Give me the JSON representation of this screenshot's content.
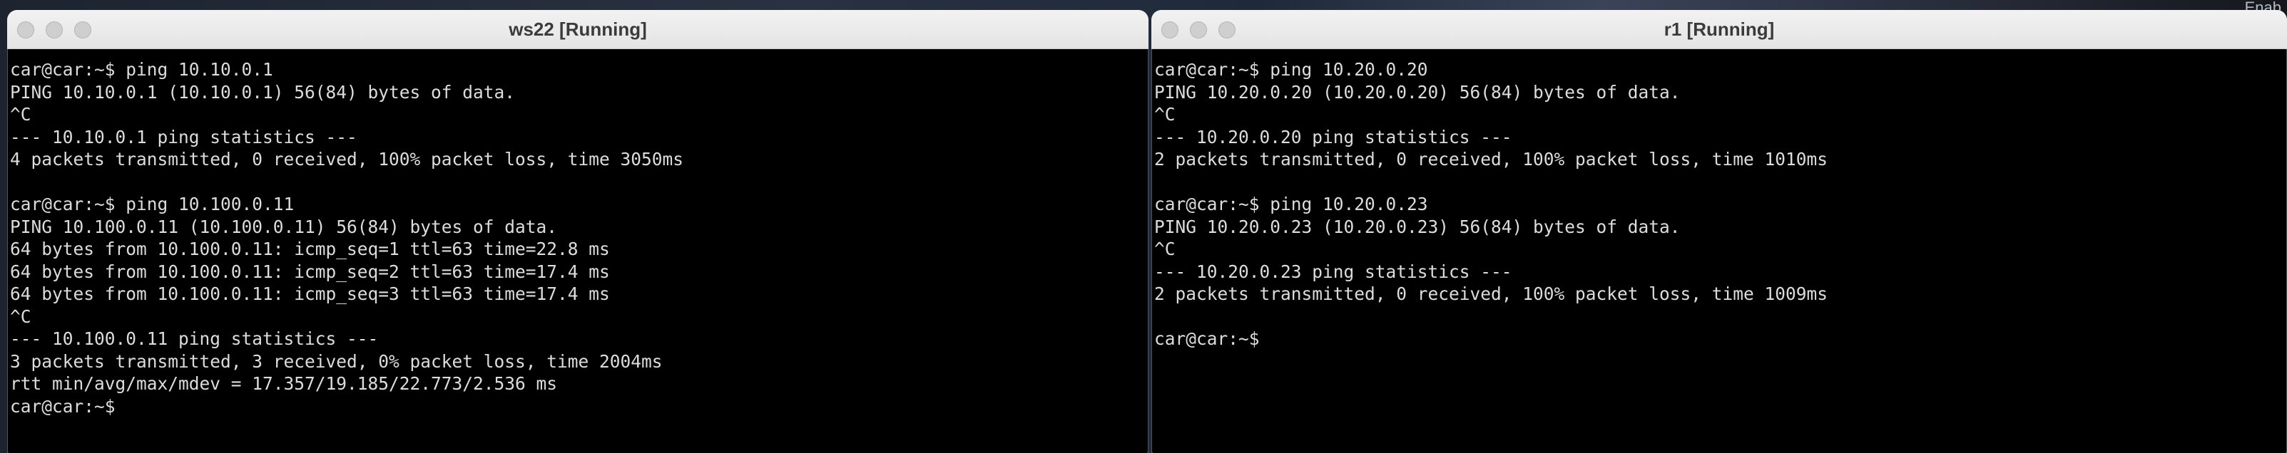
{
  "desktop": {
    "corner_text": "Enab"
  },
  "left_window": {
    "title": "ws22 [Running]",
    "lines": [
      "car@car:~$ ping 10.10.0.1",
      "PING 10.10.0.1 (10.10.0.1) 56(84) bytes of data.",
      "^C",
      "--- 10.10.0.1 ping statistics ---",
      "4 packets transmitted, 0 received, 100% packet loss, time 3050ms",
      "",
      "car@car:~$ ping 10.100.0.11",
      "PING 10.100.0.11 (10.100.0.11) 56(84) bytes of data.",
      "64 bytes from 10.100.0.11: icmp_seq=1 ttl=63 time=22.8 ms",
      "64 bytes from 10.100.0.11: icmp_seq=2 ttl=63 time=17.4 ms",
      "64 bytes from 10.100.0.11: icmp_seq=3 ttl=63 time=17.4 ms",
      "^C",
      "--- 10.100.0.11 ping statistics ---",
      "3 packets transmitted, 3 received, 0% packet loss, time 2004ms",
      "rtt min/avg/max/mdev = 17.357/19.185/22.773/2.536 ms",
      "car@car:~$"
    ]
  },
  "right_window": {
    "title": "r1 [Running]",
    "lines": [
      "car@car:~$ ping 10.20.0.20",
      "PING 10.20.0.20 (10.20.0.20) 56(84) bytes of data.",
      "^C",
      "--- 10.20.0.20 ping statistics ---",
      "2 packets transmitted, 0 received, 100% packet loss, time 1010ms",
      "",
      "car@car:~$ ping 10.20.0.23",
      "PING 10.20.0.23 (10.20.0.23) 56(84) bytes of data.",
      "^C",
      "--- 10.20.0.23 ping statistics ---",
      "2 packets transmitted, 0 received, 100% packet loss, time 1009ms",
      "",
      "car@car:~$"
    ]
  }
}
